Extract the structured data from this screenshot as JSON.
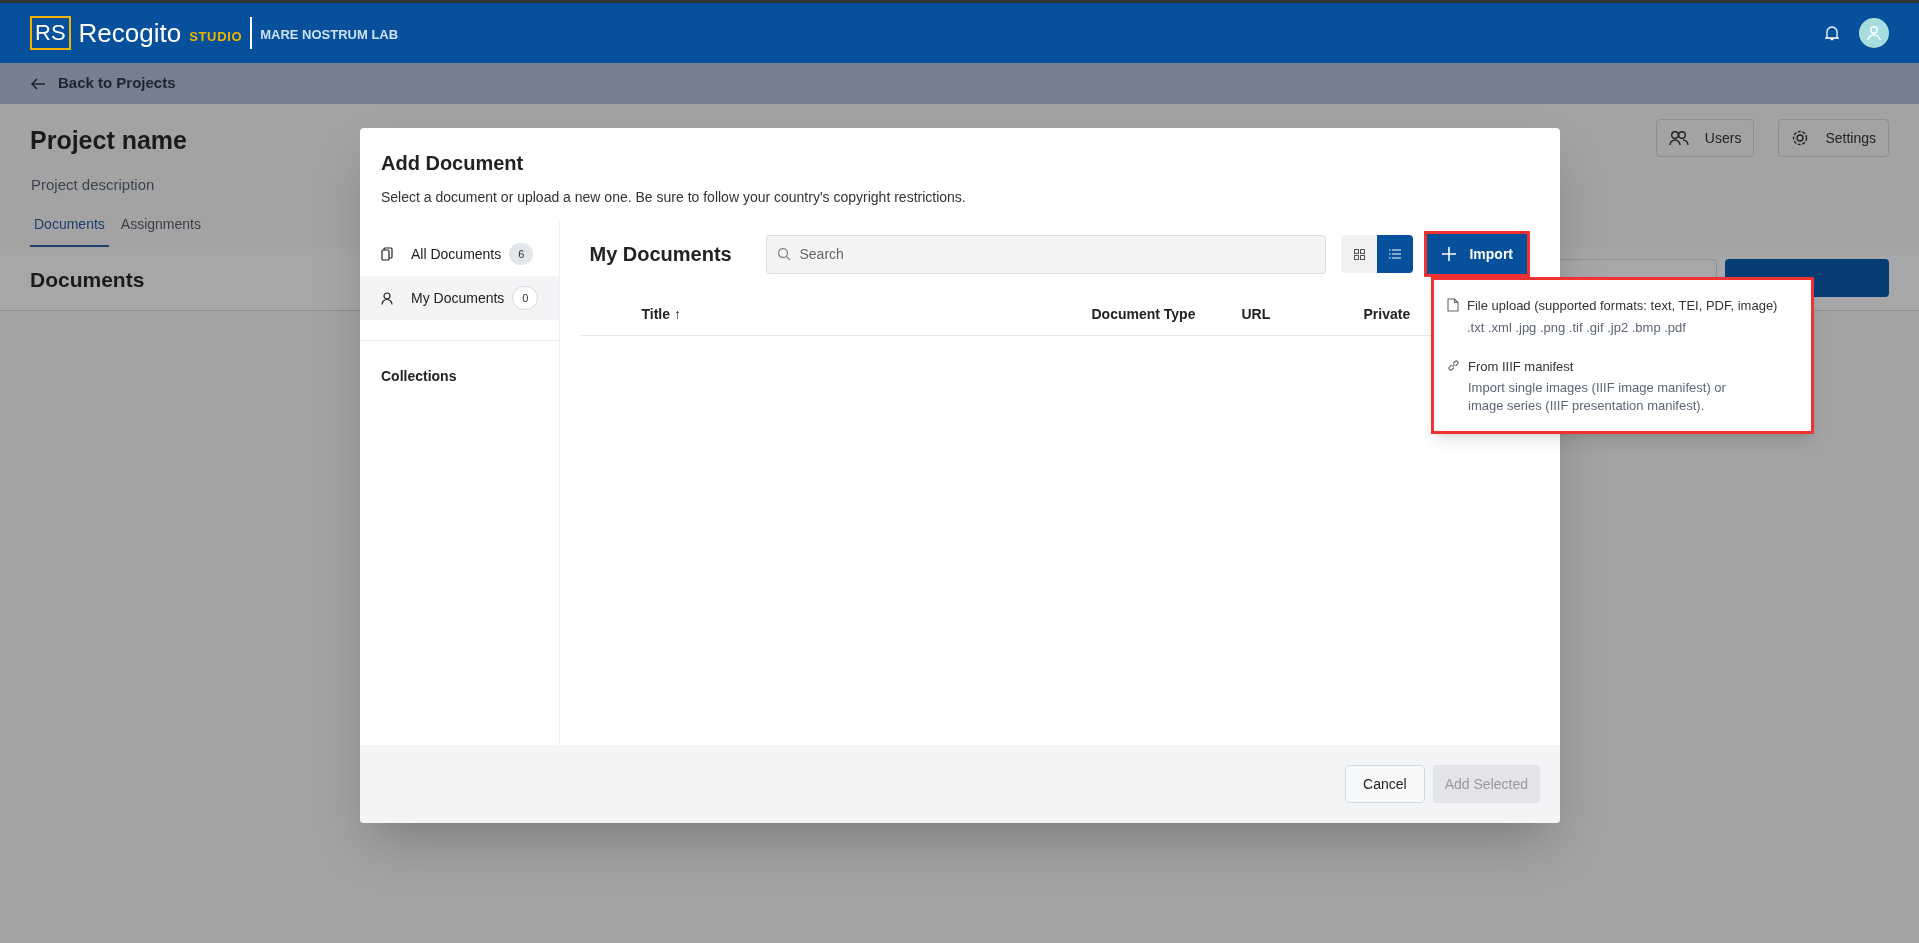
{
  "header": {
    "logo_mark": "RS",
    "brand": "Recogito",
    "brand_suffix": "STUDIO",
    "organization": "MARE NOSTRUM LAB"
  },
  "back_link": "Back to Projects",
  "project": {
    "name": "Project name",
    "description": "Project description",
    "tabs": [
      {
        "label": "Documents",
        "selected": true
      },
      {
        "label": "Assignments",
        "selected": false
      }
    ],
    "actions": [
      {
        "label": "Users",
        "kind": "users"
      },
      {
        "label": "Settings",
        "kind": "settings"
      }
    ],
    "section_title": "Documents",
    "section_buttons": [
      {
        "kind": "outline"
      },
      {
        "kind": "primary"
      }
    ]
  },
  "dialog": {
    "title": "Add Document",
    "subtitle": "Select a document or upload a new one. Be sure to follow your country's copyright restrictions.",
    "sidebar": [
      {
        "label": "All Documents",
        "count": "6",
        "kind": "all",
        "selected": false
      },
      {
        "label": "My Documents",
        "count": "0",
        "kind": "mine",
        "selected": true
      }
    ],
    "collections_heading": "Collections",
    "main_title": "My Documents",
    "search": {
      "placeholder": "Search"
    },
    "views": [
      {
        "kind": "grid",
        "selected": false
      },
      {
        "kind": "list",
        "selected": true
      }
    ],
    "import_button": "Import",
    "import_menu": [
      {
        "kind": "file",
        "title": "File upload (supported formats: text, TEI, PDF, image)",
        "detail": ".txt .xml .jpg .png .tif .gif .jp2 .bmp .pdf"
      },
      {
        "kind": "link",
        "title": "From IIIF manifest",
        "detail": "Import single images (IIIF image manifest) or image series (IIIF presentation manifest)."
      }
    ],
    "columns": [
      {
        "label": "Title ↑"
      },
      {
        "label": "Document Type"
      },
      {
        "label": "URL"
      },
      {
        "label": "Private"
      }
    ],
    "buttons": [
      {
        "label": "Cancel",
        "disabled": false,
        "kind": "secondary"
      },
      {
        "label": "Add Selected",
        "disabled": true,
        "kind": "primary"
      }
    ]
  }
}
